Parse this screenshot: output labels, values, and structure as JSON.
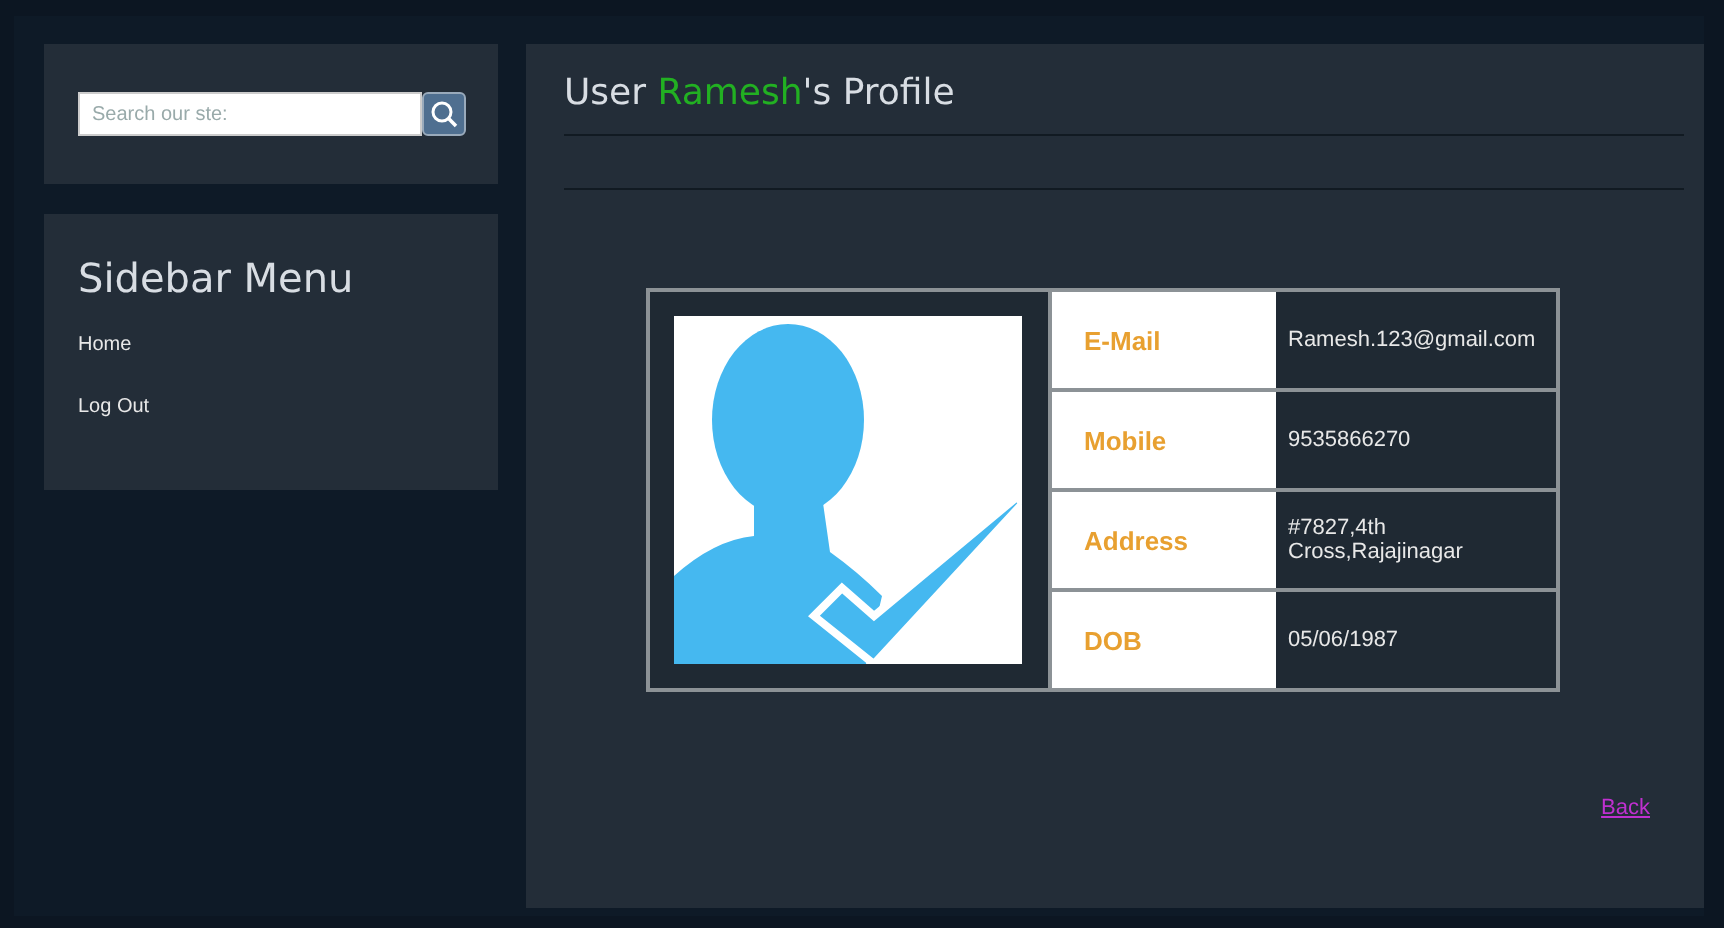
{
  "search": {
    "placeholder": "Search our ste:"
  },
  "sidebar": {
    "title": "Sidebar Menu",
    "items": [
      {
        "label": "Home"
      },
      {
        "label": "Log Out"
      }
    ]
  },
  "page_title": {
    "prefix": "User ",
    "user_name": "Ramesh",
    "suffix": "'s Profile"
  },
  "profile": {
    "fields": [
      {
        "label": "E-Mail",
        "value": "Ramesh.123@gmail.com"
      },
      {
        "label": "Mobile",
        "value": "9535866270"
      },
      {
        "label": "Address",
        "value": "#7827,4th Cross,Rajajinagar"
      },
      {
        "label": "DOB",
        "value": "05/06/1987"
      }
    ]
  },
  "back_link": "Back"
}
